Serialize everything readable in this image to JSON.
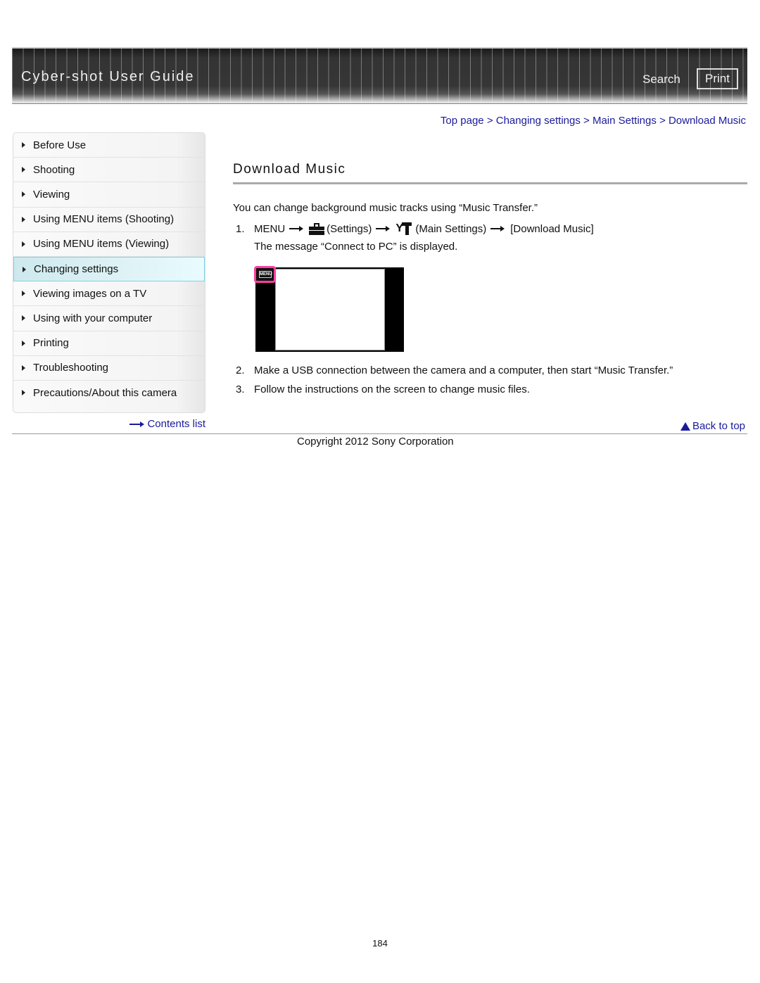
{
  "header": {
    "title": "Cyber-shot User Guide",
    "search_label": "Search",
    "print_label": "Print"
  },
  "breadcrumb": {
    "items": [
      "Top page",
      "Changing settings",
      "Main Settings",
      "Download Music"
    ],
    "separator": ">"
  },
  "sidebar": {
    "items": [
      {
        "label": "Before Use",
        "active": false
      },
      {
        "label": "Shooting",
        "active": false
      },
      {
        "label": "Viewing",
        "active": false
      },
      {
        "label": "Using MENU items (Shooting)",
        "active": false
      },
      {
        "label": "Using MENU items (Viewing)",
        "active": false
      },
      {
        "label": "Changing settings",
        "active": true
      },
      {
        "label": "Viewing images on a TV",
        "active": false
      },
      {
        "label": "Using with your computer",
        "active": false
      },
      {
        "label": "Printing",
        "active": false
      },
      {
        "label": "Troubleshooting",
        "active": false
      },
      {
        "label": "Precautions/About this camera",
        "active": false
      }
    ],
    "contents_link": "Contents list"
  },
  "main": {
    "title": "Download Music",
    "intro": "You can change background music tracks using “Music Transfer.”",
    "step1": {
      "num": "1.",
      "menu": "MENU",
      "settings": "(Settings)",
      "main_settings": "(Main Settings)",
      "target": "[Download Music]",
      "message": "The message “Connect to PC” is displayed."
    },
    "screen_menu_label": "MENU",
    "step2": {
      "num": "2.",
      "text": "Make a USB connection between the camera and a computer, then start “Music Transfer.”"
    },
    "step3": {
      "num": "3.",
      "text": "Follow the instructions on the screen to change music files."
    },
    "back_to_top": "Back to top"
  },
  "footer": {
    "copyright": "Copyright 2012 Sony Corporation",
    "page_number": "184"
  },
  "colors": {
    "link": "#1a1a9a",
    "highlight_border": "#ff3fa0",
    "active_item": "#dff3f6"
  }
}
